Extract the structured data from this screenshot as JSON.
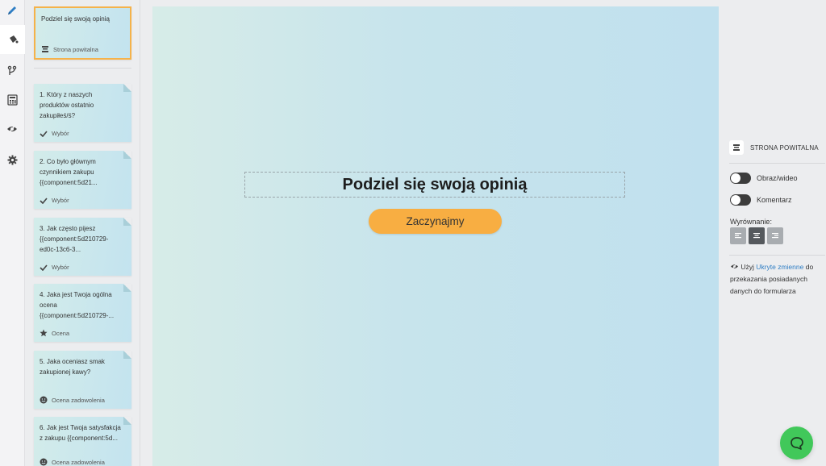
{
  "rail": {
    "items": [
      {
        "icon": "pencil-icon"
      },
      {
        "icon": "paint-bucket-icon"
      },
      {
        "icon": "branch-icon"
      },
      {
        "icon": "calculator-icon"
      },
      {
        "icon": "hidden-eye-icon"
      },
      {
        "icon": "gear-icon"
      }
    ]
  },
  "welcome_card": {
    "title": "Podziel się swoją opinią",
    "type_label": "Strona powitalna"
  },
  "questions": [
    {
      "text": "1. Który z naszych produktów ostatnio zakupiłeś/ś?",
      "type_label": "Wybór",
      "type_icon": "check-icon"
    },
    {
      "text": "2. Co było głównym czynnikiem zakupu {{component:5d21...",
      "type_label": "Wybór",
      "type_icon": "check-icon"
    },
    {
      "text": "3. Jak często pijesz {{component:5d210729-ed0c-13c6-3...",
      "type_label": "Wybór",
      "type_icon": "check-icon"
    },
    {
      "text": "4. Jaka jest Twoja ogólna ocena {{component:5d210729-...",
      "type_label": "Ocena",
      "type_icon": "star-icon"
    },
    {
      "text": "5. Jaka oceniasz smak zakupionej kawy?",
      "type_label": "Ocena zadowolenia",
      "type_icon": "smiley-icon"
    },
    {
      "text": "6. Jak jest Twoja satysfakcja z zakupu {{component:5d...",
      "type_label": "Ocena zadowolenia",
      "type_icon": "smiley-icon"
    }
  ],
  "canvas": {
    "heading": "Podziel się swoją opinią",
    "start_button": "Zaczynajmy"
  },
  "panel": {
    "title": "STRONA POWITALNA",
    "toggle_media": "Obraz/wideo",
    "toggle_comment": "Komentarz",
    "alignment_label": "Wyrównanie:",
    "alignment_selected": "center",
    "note_prefix": "Użyj",
    "note_link": "Ukryte zmienne",
    "note_suffix": "do przekazania posiadanych danych do formularza"
  },
  "colors": {
    "accent": "#f8ae42",
    "chat": "#41c85a",
    "link": "#2f7ec4"
  }
}
